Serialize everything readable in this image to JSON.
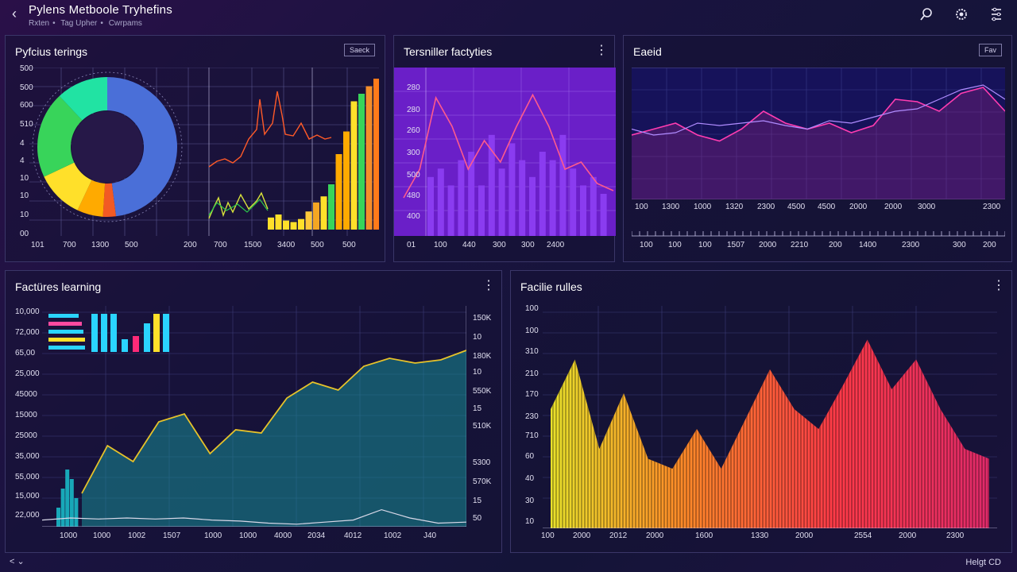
{
  "header": {
    "title": "Pylens Metboole Tryhefins",
    "breadcrumb": [
      "Rxten",
      "Tag Upher",
      "Cwrpams"
    ]
  },
  "panels": {
    "p1": {
      "title": "Pyfcius terings",
      "button": "Saeck",
      "y_ticks": [
        "500",
        "500",
        "600",
        "510",
        "4",
        "4",
        "10",
        "10",
        "10",
        "00"
      ],
      "x_ticks": [
        "101",
        "700",
        "1300",
        "500",
        "200",
        "700",
        "1500",
        "3400",
        "500",
        "500"
      ]
    },
    "p2": {
      "title": "Tersniller factyties",
      "menu": "⋮",
      "y_ticks": [
        "280",
        "280",
        "260",
        "300",
        "500",
        "480",
        "400"
      ],
      "x_ticks": [
        "01",
        "100",
        "440",
        "300",
        "300",
        "2400"
      ]
    },
    "p3": {
      "title": "Eaeid",
      "button": "Fav",
      "x_ticks_upper": [
        "100",
        "1300",
        "1000",
        "1320",
        "2300",
        "4500",
        "4500",
        "2000",
        "2000",
        "3000",
        "2300"
      ],
      "x_ticks_lower": [
        "100",
        "100",
        "100",
        "1507",
        "2000",
        "2210",
        "200",
        "1400",
        "2300",
        "300",
        "200"
      ]
    },
    "p4": {
      "title": "Factüres learning",
      "menu": "⋮",
      "y_ticks_left": [
        "10,000",
        "72,000",
        "65,00",
        "25,000",
        "45000",
        "15000",
        "25000",
        "35,000",
        "55,000",
        "15,000",
        "22,000"
      ],
      "y_ticks_right": [
        "150K",
        "10",
        "180K",
        "10",
        "550K",
        "15",
        "510K",
        "5300",
        "570K",
        "15",
        "50"
      ],
      "x_ticks": [
        "1000",
        "1000",
        "1002",
        "1507",
        "1000",
        "1000",
        "4000",
        "2034",
        "4012",
        "1002",
        "J40"
      ]
    },
    "p5": {
      "title": "Facilie rulles",
      "menu": "⋮",
      "y_ticks": [
        "100",
        "100",
        "310",
        "210",
        "170",
        "230",
        "710",
        "60",
        "40",
        "30",
        "10"
      ],
      "x_ticks": [
        "100",
        "2000",
        "2012",
        "2000",
        "1600",
        "1330",
        "2000",
        "2554",
        "2000",
        "2300"
      ]
    }
  },
  "footer": {
    "left": "< ⌄",
    "right": "Helgt CD"
  },
  "chart_data": [
    {
      "type": "pie",
      "title": "Pyfcius terings",
      "values": [
        48,
        3,
        6,
        11,
        20,
        12
      ],
      "colors": [
        "#4a6fd8",
        "#f25a24",
        "#ffaa00",
        "#ffe02a",
        "#38d45a",
        "#21e3a3"
      ]
    },
    {
      "type": "bar",
      "title": "Pyfcius terings",
      "values": [
        8,
        10,
        6,
        5,
        7,
        12,
        18,
        22,
        30,
        50,
        65,
        85,
        90,
        95,
        100,
        100
      ],
      "colors": [
        "#ffe02a",
        "#ffe02a",
        "#ffe02a",
        "#ffe02a",
        "#ffe02a",
        "#ffc93a",
        "#f5a623",
        "#ffe02a",
        "#38d45a",
        "#ffaa00",
        "#ffaa00",
        "#ffe02a",
        "#38d45a",
        "#f58e2a",
        "#ff7a1a",
        "#38d45a"
      ]
    },
    {
      "type": "line",
      "title": "Tersniller factyties",
      "series": [
        {
          "color": "#ff5a8c",
          "values": [
            20,
            40,
            90,
            70,
            40,
            60,
            45,
            70,
            92,
            70,
            40,
            45,
            30,
            25
          ]
        }
      ],
      "bars": [
        35,
        40,
        30,
        45,
        50,
        30,
        60,
        40,
        55,
        45,
        35,
        50,
        45,
        60,
        40,
        30,
        35,
        25
      ]
    },
    {
      "type": "line",
      "title": "Eaeid",
      "series": [
        {
          "color": "#ff3cb0",
          "values": [
            50,
            55,
            60,
            50,
            45,
            55,
            70,
            60,
            55,
            60,
            52,
            58,
            80,
            78,
            70,
            85,
            90,
            70
          ]
        },
        {
          "color": "#b08cff",
          "values": [
            55,
            50,
            52,
            60,
            58,
            60,
            62,
            58,
            55,
            62,
            60,
            65,
            70,
            72,
            80,
            88,
            92,
            80
          ]
        }
      ]
    },
    {
      "type": "area",
      "title": "Factüres learning",
      "series": [
        {
          "color": "#e6c22a",
          "values": [
            10,
            40,
            30,
            55,
            60,
            35,
            50,
            48,
            70,
            80,
            75,
            90,
            95,
            92,
            94,
            100
          ]
        },
        {
          "color": "#d8d8e8",
          "values": [
            8,
            10,
            9,
            10,
            9,
            10,
            8,
            7,
            5,
            4,
            6,
            8,
            18,
            10,
            5,
            6
          ]
        }
      ],
      "bars": [
        20,
        40,
        60,
        50,
        30
      ]
    },
    {
      "type": "area",
      "title": "Facilie rulles",
      "series": [
        {
          "color": "#ff6a3a",
          "values": [
            60,
            85,
            40,
            68,
            35,
            30,
            50,
            30,
            55,
            80,
            60,
            50,
            72,
            95,
            70,
            85,
            60,
            40,
            35
          ]
        }
      ]
    }
  ]
}
